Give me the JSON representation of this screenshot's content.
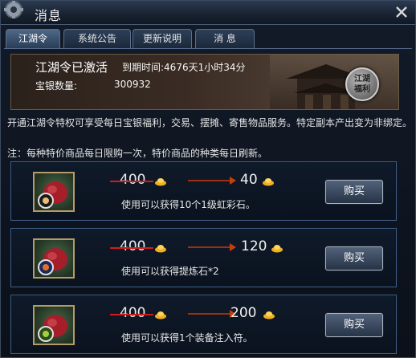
{
  "window": {
    "title": "消息",
    "icons": {
      "gear": "gear-icon",
      "close": "close-icon"
    }
  },
  "tabs": [
    {
      "label": "江湖令",
      "active": true
    },
    {
      "label": "系统公告",
      "active": false
    },
    {
      "label": "更新说明",
      "active": false
    },
    {
      "label": "消  息",
      "active": false
    }
  ],
  "banner": {
    "title": "江湖令已激活",
    "expire": "到期时间:4676天1小时34分",
    "silver_label": "宝银数量:",
    "silver_value": "300932",
    "seal_text": "江湖\n福利"
  },
  "description": "开通江湖令特权可享受每日宝银福利，交易、摆摊、寄售物品服务。特定副本产出变为非绑定。",
  "note": "注：每种特价商品每日限购一次，特价商品的种类每日刷新。",
  "items": [
    {
      "old_price": "400",
      "new_price": "40",
      "desc": "使用可以获得10个1级虹彩石。",
      "buy_label": "购买",
      "icon": "red-pouch-icon"
    },
    {
      "old_price": "400",
      "new_price": "120",
      "desc": "使用可以获得提炼石*2",
      "buy_label": "购买",
      "icon": "red-pouch-icon"
    },
    {
      "old_price": "400",
      "new_price": "200",
      "desc": "使用可以获得1个装备注入符。",
      "buy_label": "购买",
      "icon": "red-pouch-icon"
    }
  ],
  "colors": {
    "accent_border": "#3f5f88",
    "strike_red": "#d01c1c",
    "coin_gold": "#f0b020"
  }
}
